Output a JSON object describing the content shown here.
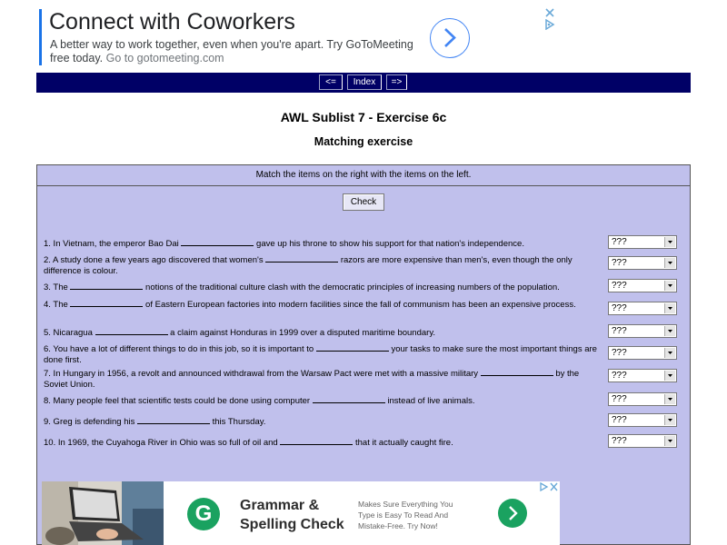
{
  "ad_top": {
    "title": "Connect with Coworkers",
    "description": "A better way to work together, even when you're apart. Try GoToMeeting free today.",
    "url_text": "Go to gotomeeting.com"
  },
  "nav": {
    "prev_label": "<=",
    "index_label": "Index",
    "next_label": "=>"
  },
  "page": {
    "title": "AWL Sublist 7 - Exercise 6c",
    "subtitle": "Matching exercise",
    "instructions": "Match the items on the right with the items on the left.",
    "check_label": "Check"
  },
  "questions": [
    {
      "pre": "1. In Vietnam, the emperor Bao Dai",
      "post": "gave up his throne to show his support for that nation's independence.",
      "answer": "???"
    },
    {
      "pre": "2. A study done a few years ago discovered that women's",
      "post": "razors are more expensive than men's, even though the only difference is colour.",
      "answer": "???"
    },
    {
      "pre": "3. The",
      "post": "notions of the traditional culture clash with the democratic principles of increasing numbers of the population.",
      "answer": "???"
    },
    {
      "pre": "4. The",
      "post": "of Eastern European factories into modern facilities since the fall of communism has been an expensive process.",
      "answer": "???"
    },
    {
      "pre": "5. Nicaragua",
      "post": "a claim against Honduras in 1999 over a disputed maritime boundary.",
      "answer": "???"
    },
    {
      "pre": "6. You have a lot of different things to do in this job, so it is important to",
      "post": "your tasks to make sure the most important things are done first.",
      "answer": "???"
    },
    {
      "pre": "7. In Hungary in 1956, a revolt and announced withdrawal from the Warsaw Pact were met with a massive military",
      "post": "by the Soviet Union.",
      "answer": "???"
    },
    {
      "pre": "8. Many people feel that scientific tests could be done using computer",
      "post": "instead of live animals.",
      "answer": "???"
    },
    {
      "pre": "9. Greg is defending his",
      "post": "this Thursday.",
      "answer": "???"
    },
    {
      "pre": "10. In 1969, the Cuyahoga River in Ohio was so full of oil and",
      "post": "that it actually caught fire.",
      "answer": "???"
    }
  ],
  "ad_bottom": {
    "logo_letter": "G",
    "title_line1": "Grammar &",
    "title_line2": "Spelling Check",
    "desc_line1": "Makes Sure Everything You",
    "desc_line2": "Type is Easy To Read And",
    "desc_line3": "Mistake-Free. Try Now!"
  },
  "colors": {
    "nav_bar": "#000066",
    "panel_bg": "#c0c0ec",
    "ad_accent": "#4285f4",
    "ad_green": "#1aa260"
  }
}
